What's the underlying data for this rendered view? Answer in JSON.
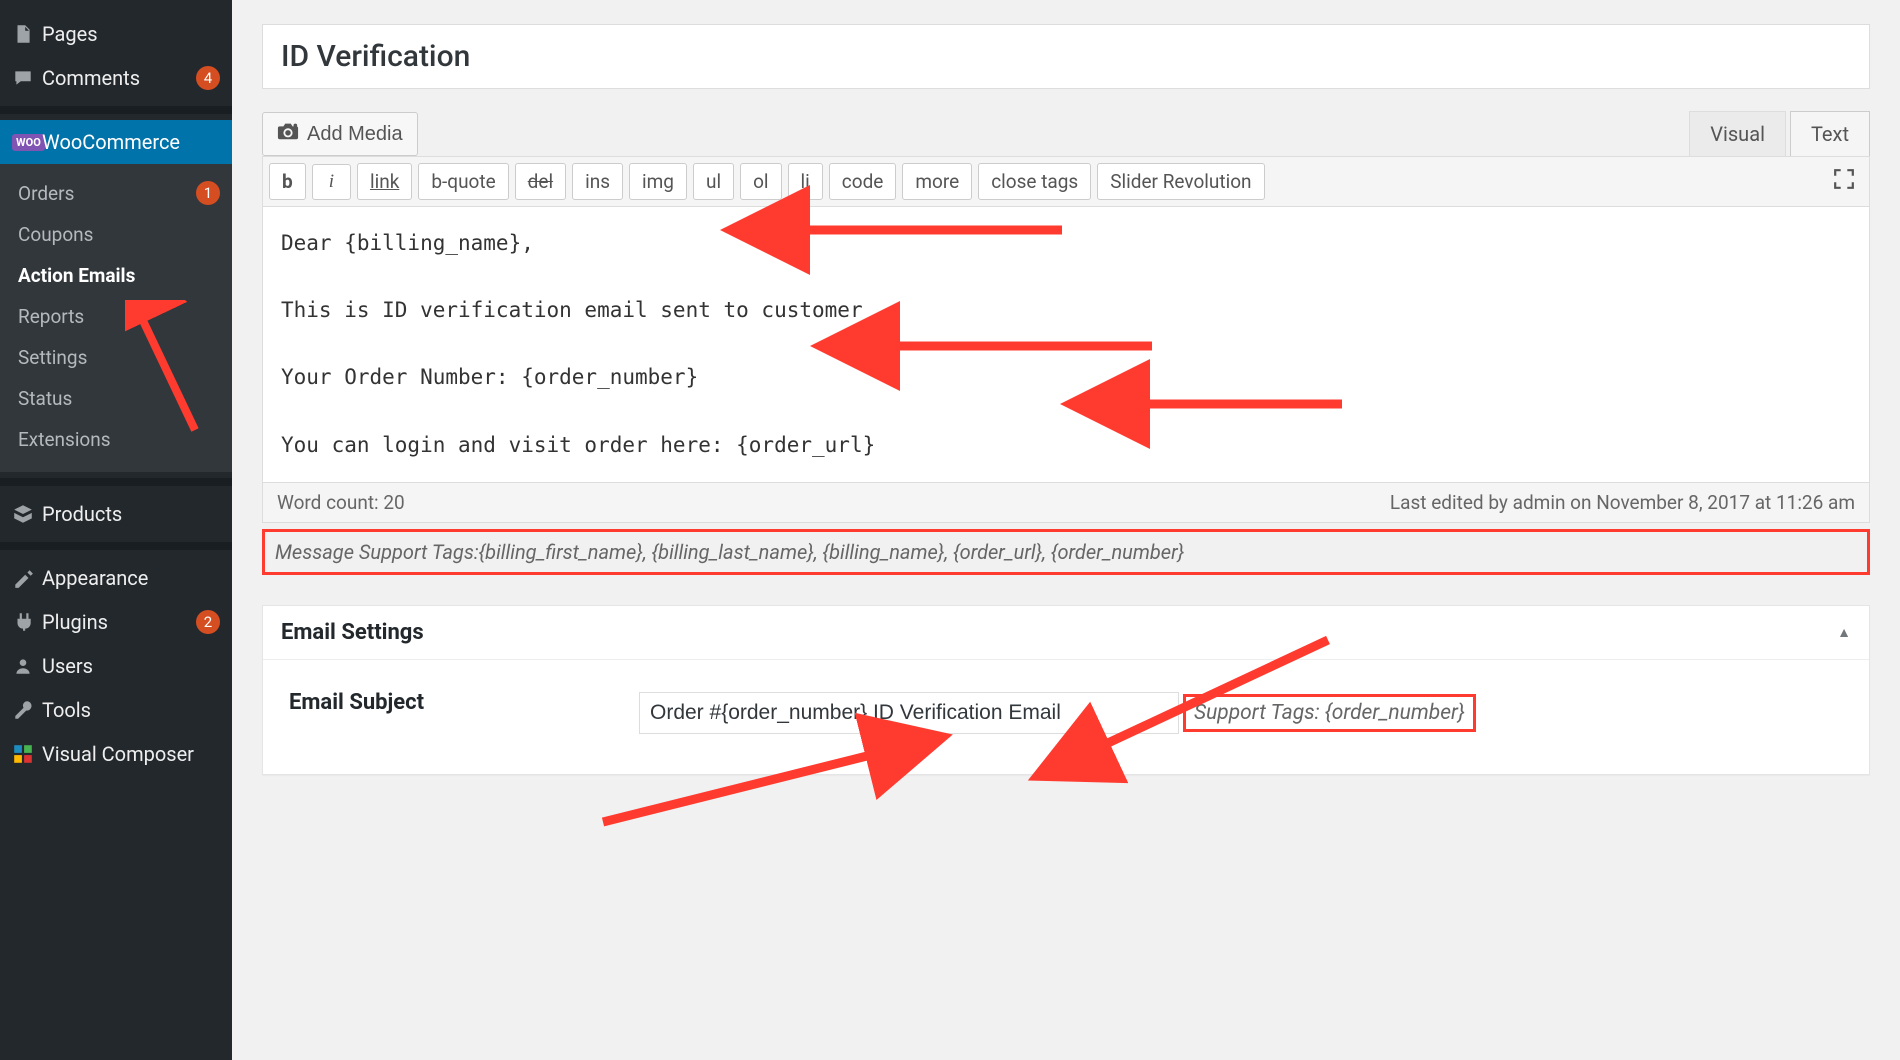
{
  "sidebar": {
    "items": [
      {
        "icon": "pages-icon",
        "label": "Pages"
      },
      {
        "icon": "comments-icon",
        "label": "Comments",
        "badge": "4"
      }
    ],
    "woo": {
      "label": "WooCommerce",
      "badge_text": "WOO"
    },
    "woo_sub": [
      {
        "label": "Orders",
        "badge": "1"
      },
      {
        "label": "Coupons"
      },
      {
        "label": "Action Emails",
        "current": true
      },
      {
        "label": "Reports"
      },
      {
        "label": "Settings"
      },
      {
        "label": "Status"
      },
      {
        "label": "Extensions"
      }
    ],
    "items2": [
      {
        "icon": "products-icon",
        "label": "Products"
      }
    ],
    "items3": [
      {
        "icon": "appearance-icon",
        "label": "Appearance"
      },
      {
        "icon": "plugins-icon",
        "label": "Plugins",
        "badge": "2"
      },
      {
        "icon": "users-icon",
        "label": "Users"
      },
      {
        "icon": "tools-icon",
        "label": "Tools"
      },
      {
        "icon": "vc-icon",
        "label": "Visual Composer"
      }
    ]
  },
  "title": "ID Verification",
  "editor": {
    "add_media": "Add Media",
    "tabs": {
      "visual": "Visual",
      "text": "Text"
    },
    "toolbar": [
      "b",
      "i",
      "link",
      "b-quote",
      "del",
      "ins",
      "img",
      "ul",
      "ol",
      "li",
      "code",
      "more",
      "close tags",
      "Slider Revolution"
    ],
    "content": "Dear {billing_name},\n\nThis is ID verification email sent to customer\n\nYour Order Number: {order_number}\n\nYou can login and visit order here: {order_url}",
    "word_count_label": "Word count: 20",
    "last_edited": "Last edited by admin on November 8, 2017 at 11:26 am",
    "support_tags": "Message Support Tags:{billing_first_name}, {billing_last_name}, {billing_name}, {order_url}, {order_number}"
  },
  "settings": {
    "heading": "Email Settings",
    "subject_label": "Email Subject",
    "subject_value": "Order #{order_number} ID Verification Email",
    "subject_support": "Support Tags: {order_number}"
  }
}
